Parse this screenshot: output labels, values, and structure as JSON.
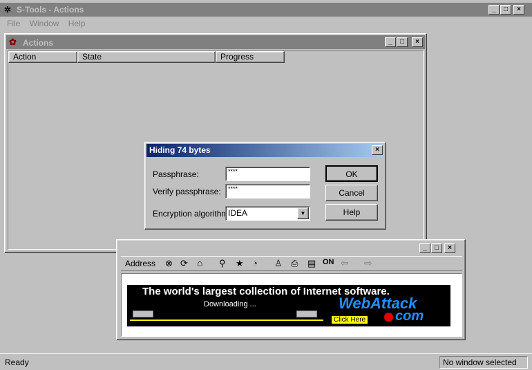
{
  "app": {
    "title": "S-Tools - Actions",
    "title_icon": "s-tools-icon"
  },
  "menu": {
    "items": [
      "File",
      "Window",
      "Help"
    ]
  },
  "actions_window": {
    "title": "Actions",
    "columns": [
      "Action",
      "State",
      "Progress"
    ]
  },
  "dialog": {
    "title": "Hiding 74 bytes",
    "passphrase_label": "Passphrase:",
    "passphrase_value": "****",
    "verify_label": "Verify passphrase:",
    "verify_value": "****",
    "algo_label": "Encryption algorithm:",
    "algo_value": "IDEA",
    "ok": "OK",
    "cancel": "Cancel",
    "help": "Help"
  },
  "browser": {
    "address_label": "Address",
    "banner_headline": "The world's largest collection of Internet software.",
    "banner_status": "Downloading ...",
    "banner_brand_1": "WebAttack",
    "banner_brand_2": "com",
    "banner_click": "Click Here"
  },
  "status": {
    "left": "Ready",
    "right": "No window selected"
  },
  "colors": {
    "dialog_title_start": "#0a246a",
    "dialog_title_end": "#a6caf0",
    "inactive_title": "#808080",
    "banner_bg": "#000000",
    "brand_blue": "#1e90ff",
    "click_yellow": "#ffff00"
  }
}
